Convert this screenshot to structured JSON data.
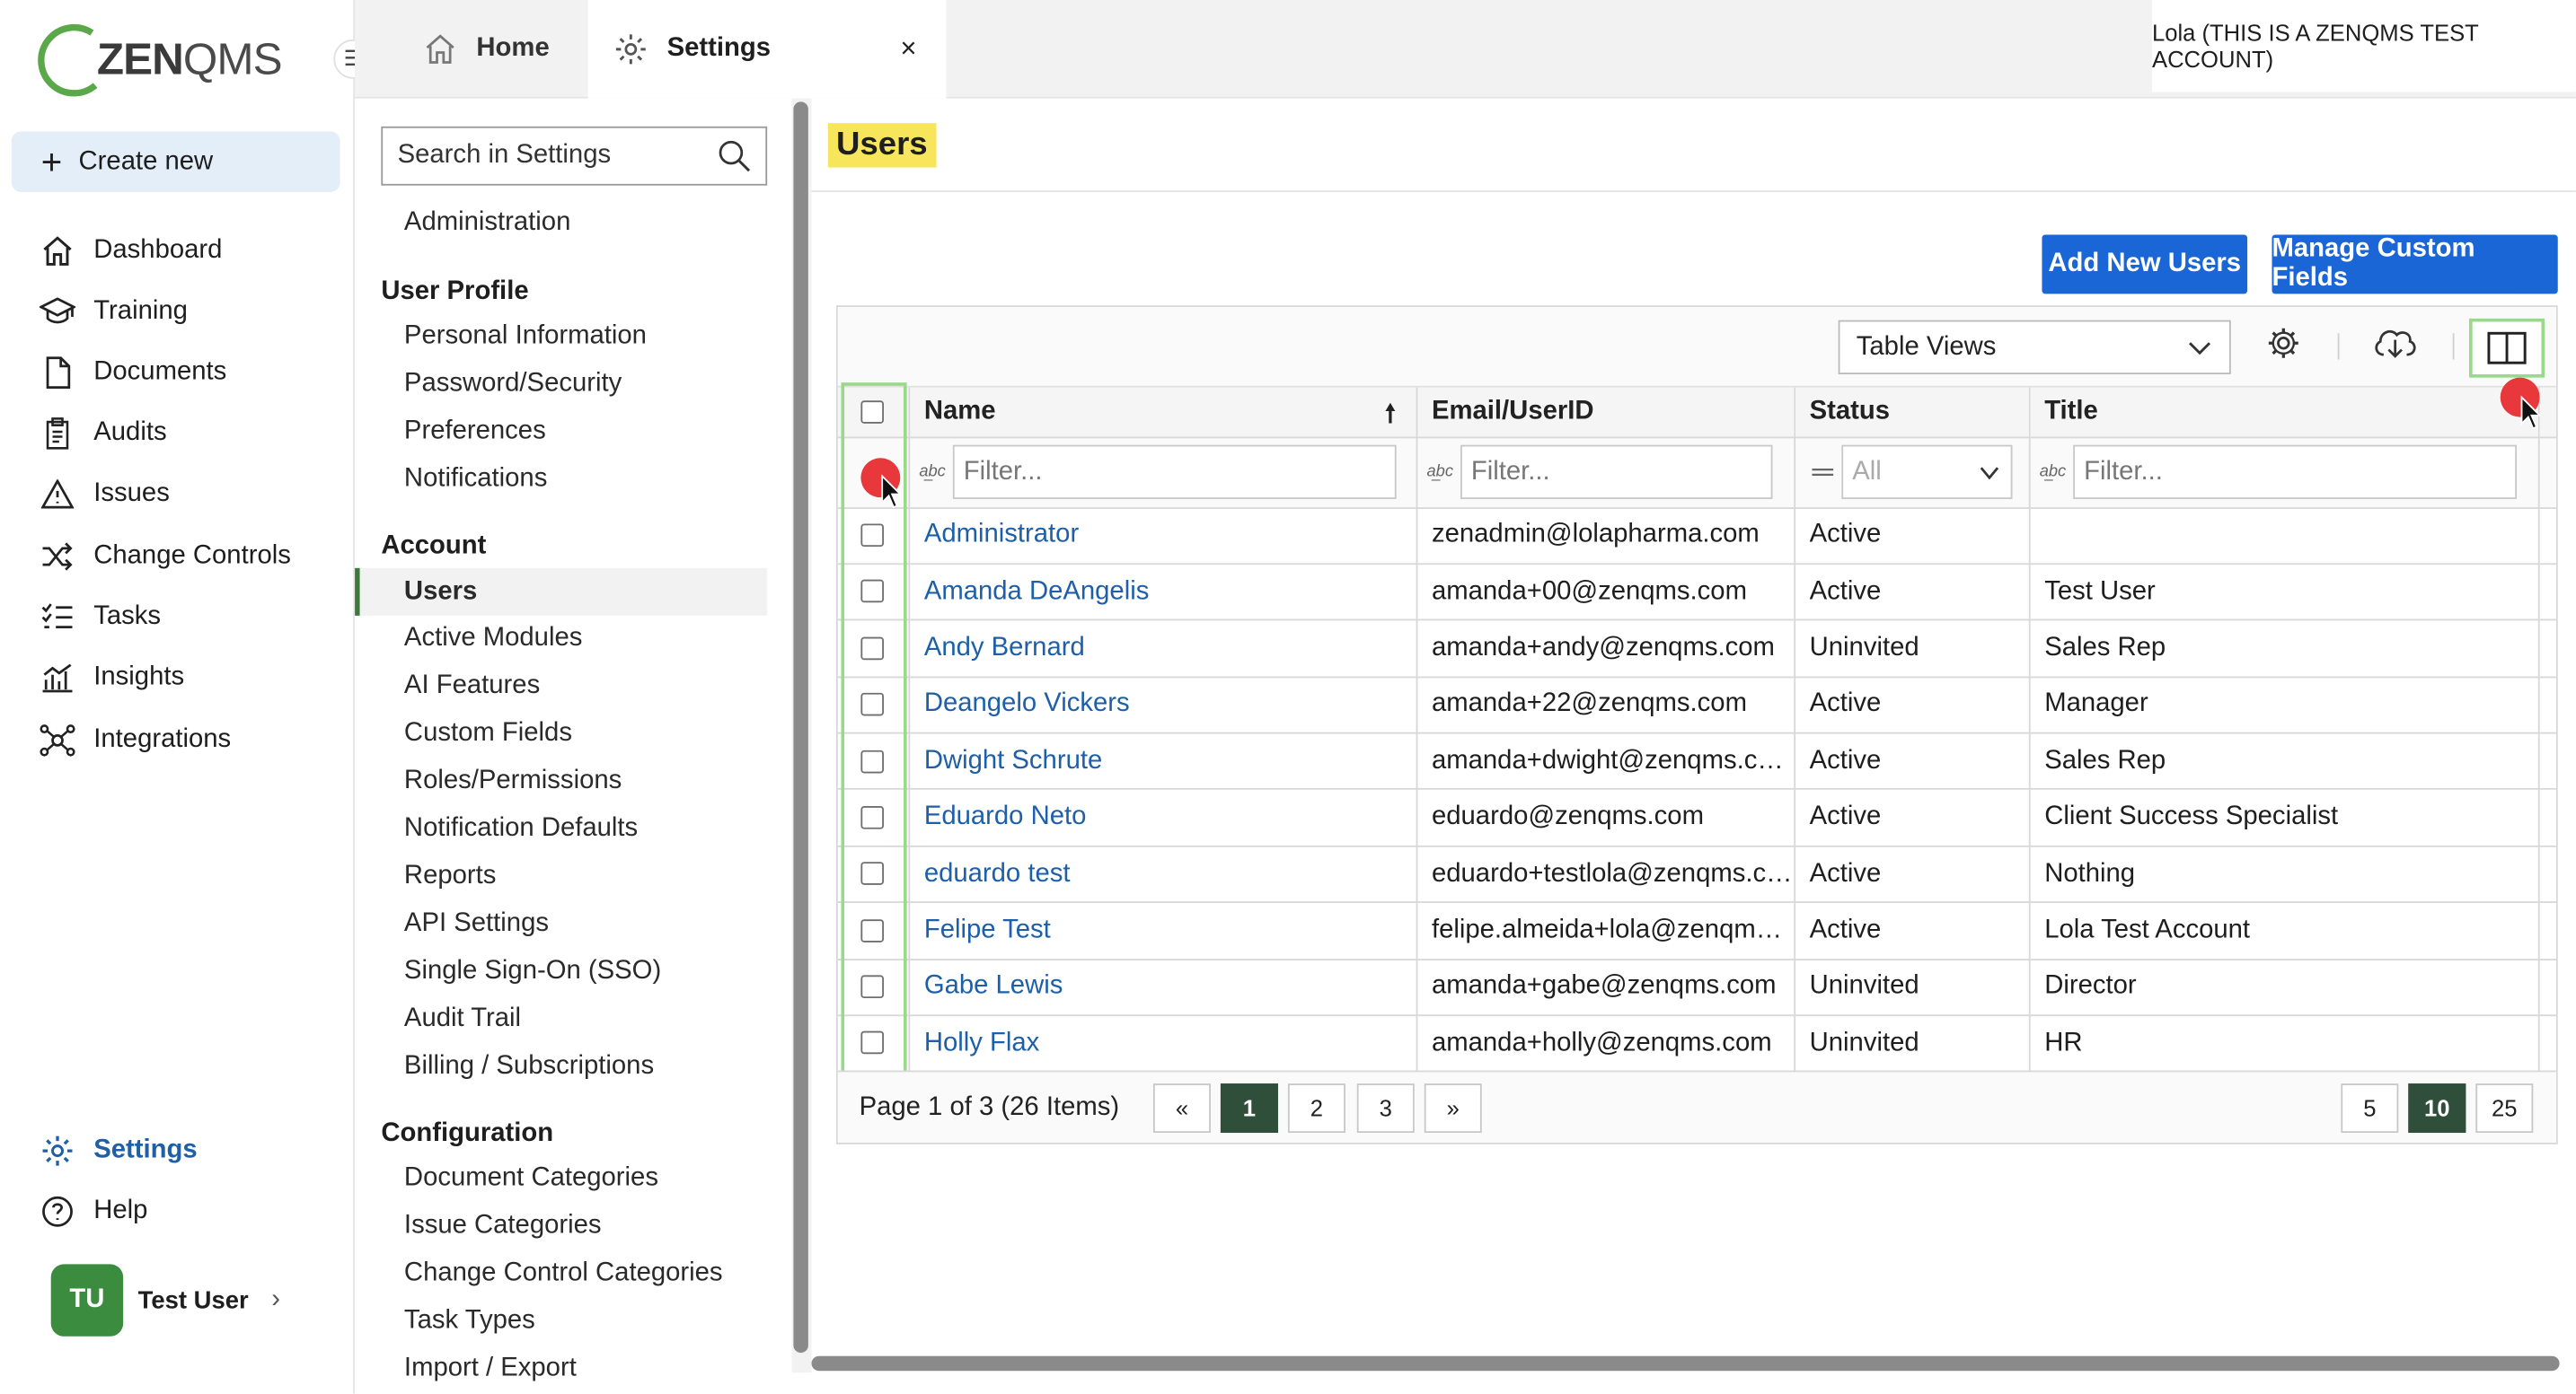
{
  "brand": {
    "logo_text_bold": "ZEN",
    "logo_text_rest": "QMS"
  },
  "nav": {
    "create_new": "Create new",
    "items": [
      {
        "label": "Dashboard",
        "icon": "home-icon"
      },
      {
        "label": "Training",
        "icon": "graduation-cap-icon"
      },
      {
        "label": "Documents",
        "icon": "document-icon"
      },
      {
        "label": "Audits",
        "icon": "clipboard-icon"
      },
      {
        "label": "Issues",
        "icon": "warning-icon"
      },
      {
        "label": "Change Controls",
        "icon": "shuffle-icon"
      },
      {
        "label": "Tasks",
        "icon": "checklist-icon"
      },
      {
        "label": "Insights",
        "icon": "chart-icon"
      },
      {
        "label": "Integrations",
        "icon": "network-icon"
      }
    ],
    "settings": "Settings",
    "help": "Help",
    "user": {
      "initials": "TU",
      "name": "Test User"
    }
  },
  "tabs": {
    "home": "Home",
    "settings": "Settings",
    "close": "×"
  },
  "account_label": "Lola (THIS IS A ZENQMS TEST ACCOUNT)",
  "settings_menu": {
    "search_placeholder": "Search in Settings",
    "administration": "Administration",
    "user_profile": {
      "heading": "User Profile",
      "items": [
        "Personal Information",
        "Password/Security",
        "Preferences",
        "Notifications"
      ]
    },
    "account": {
      "heading": "Account",
      "items": [
        "Users",
        "Active Modules",
        "AI Features",
        "Custom Fields",
        "Roles/Permissions",
        "Notification Defaults",
        "Reports",
        "API Settings",
        "Single Sign-On (SSO)",
        "Audit Trail",
        "Billing / Subscriptions"
      ]
    },
    "configuration": {
      "heading": "Configuration",
      "items": [
        "Document Categories",
        "Issue Categories",
        "Change Control Categories",
        "Task Types",
        "Import / Export"
      ]
    }
  },
  "main": {
    "title": "Users",
    "add_users": "Add New Users",
    "manage_fields": "Manage Custom Fields",
    "table_views": "Table Views",
    "columns": {
      "name": "Name",
      "email": "Email/UserID",
      "status": "Status",
      "title": "Title"
    },
    "filter_placeholder": "Filter...",
    "status_filter": "All",
    "rows": [
      {
        "name": "Administrator",
        "email": "zenadmin@lolapharma.com",
        "status": "Active",
        "title": ""
      },
      {
        "name": "Amanda DeAngelis",
        "email": "amanda+00@zenqms.com",
        "status": "Active",
        "title": "Test User"
      },
      {
        "name": "Andy Bernard",
        "email": "amanda+andy@zenqms.com",
        "status": "Uninvited",
        "title": "Sales Rep"
      },
      {
        "name": "Deangelo Vickers",
        "email": "amanda+22@zenqms.com",
        "status": "Active",
        "title": "Manager"
      },
      {
        "name": "Dwight Schrute",
        "email": "amanda+dwight@zenqms.com",
        "status": "Active",
        "title": "Sales Rep"
      },
      {
        "name": "Eduardo Neto",
        "email": "eduardo@zenqms.com",
        "status": "Active",
        "title": "Client Success Specialist"
      },
      {
        "name": "eduardo test",
        "email": "eduardo+testlola@zenqms.com",
        "status": "Active",
        "title": "Nothing"
      },
      {
        "name": "Felipe Test",
        "email": "felipe.almeida+lola@zenqms....",
        "status": "Active",
        "title": "Lola Test Account"
      },
      {
        "name": "Gabe Lewis",
        "email": "amanda+gabe@zenqms.com",
        "status": "Uninvited",
        "title": "Director"
      },
      {
        "name": "Holly Flax",
        "email": "amanda+holly@zenqms.com",
        "status": "Uninvited",
        "title": "HR"
      }
    ],
    "pager": {
      "label": "Page 1 of 3 (26 Items)",
      "first": "«",
      "last": "»",
      "pages": [
        "1",
        "2",
        "3"
      ],
      "current_page": "1",
      "sizes": [
        "5",
        "10",
        "25"
      ],
      "current_size": "10"
    }
  },
  "colors": {
    "accent": "#1a66d6",
    "highlight": "#f7e65b",
    "link": "#1d5fa8",
    "active_page": "#2f4f3a"
  }
}
